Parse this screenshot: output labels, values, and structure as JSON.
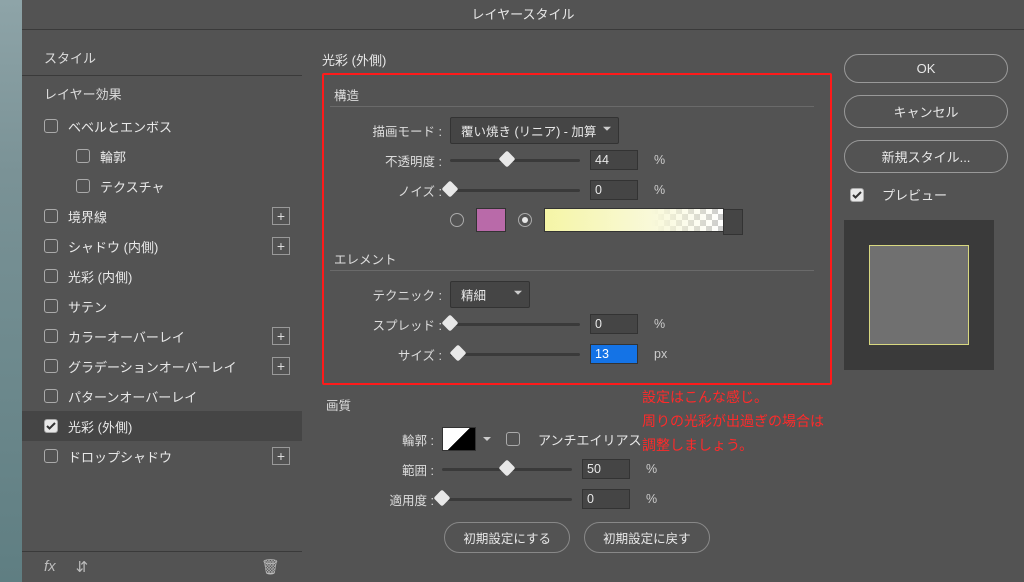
{
  "title": "レイヤースタイル",
  "sidebar": {
    "head_styles": "スタイル",
    "head_effects": "レイヤー効果",
    "items": [
      {
        "label": "ベベルとエンボス",
        "checked": false,
        "indent": false,
        "plus": false
      },
      {
        "label": "輪郭",
        "checked": false,
        "indent": true,
        "plus": false
      },
      {
        "label": "テクスチャ",
        "checked": false,
        "indent": true,
        "plus": false
      },
      {
        "label": "境界線",
        "checked": false,
        "indent": false,
        "plus": true
      },
      {
        "label": "シャドウ (内側)",
        "checked": false,
        "indent": false,
        "plus": true
      },
      {
        "label": "光彩 (内側)",
        "checked": false,
        "indent": false,
        "plus": false
      },
      {
        "label": "サテン",
        "checked": false,
        "indent": false,
        "plus": false
      },
      {
        "label": "カラーオーバーレイ",
        "checked": false,
        "indent": false,
        "plus": true
      },
      {
        "label": "グラデーションオーバーレイ",
        "checked": false,
        "indent": false,
        "plus": true
      },
      {
        "label": "パターンオーバーレイ",
        "checked": false,
        "indent": false,
        "plus": false
      },
      {
        "label": "光彩 (外側)",
        "checked": true,
        "indent": false,
        "plus": false,
        "selected": true
      },
      {
        "label": "ドロップシャドウ",
        "checked": false,
        "indent": false,
        "plus": true
      }
    ],
    "footer_fx": "fx"
  },
  "main": {
    "heading": "光彩 (外側)",
    "structure": {
      "legend": "構造",
      "blend_label": "描画モード :",
      "blend_value": "覆い焼き (リニア) - 加算",
      "opacity_label": "不透明度 :",
      "opacity_value": "44",
      "opacity_unit": "%",
      "noise_label": "ノイズ :",
      "noise_value": "0",
      "noise_unit": "%"
    },
    "element": {
      "legend": "エレメント",
      "technique_label": "テクニック :",
      "technique_value": "精細",
      "spread_label": "スプレッド :",
      "spread_value": "0",
      "spread_unit": "%",
      "size_label": "サイズ :",
      "size_value": "13",
      "size_unit": "px"
    },
    "quality": {
      "legend": "画質",
      "contour_label": "輪郭 :",
      "antialias_label": "アンチエイリアス",
      "range_label": "範囲 :",
      "range_value": "50",
      "range_unit": "%",
      "jitter_label": "適用度 :",
      "jitter_value": "0",
      "jitter_unit": "%"
    },
    "btn_default": "初期設定にする",
    "btn_reset": "初期設定に戻す"
  },
  "right": {
    "ok": "OK",
    "cancel": "キャンセル",
    "newstyle": "新規スタイル...",
    "preview_label": "プレビュー"
  },
  "annotation": {
    "line1": "設定はこんな感じ。",
    "line2": "周りの光彩が出過ぎの場合は",
    "line3": "調整しましょう。"
  }
}
